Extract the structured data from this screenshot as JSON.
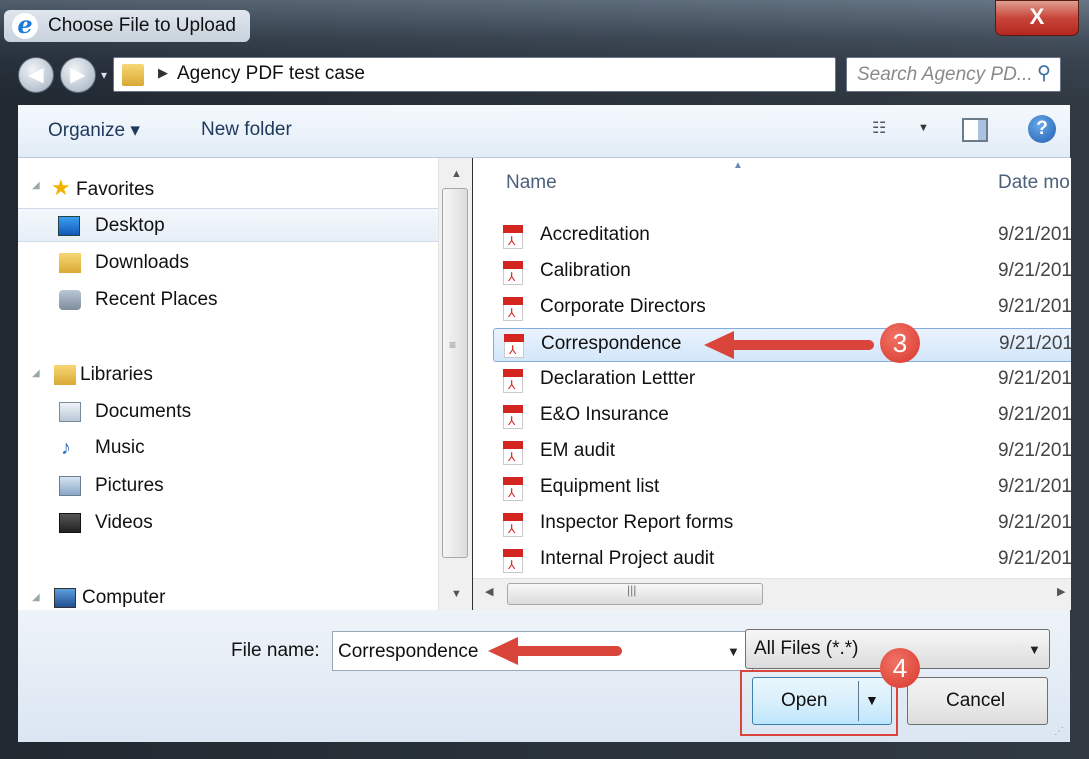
{
  "window": {
    "title": "Choose File to Upload",
    "close_glyph": "X"
  },
  "address": {
    "path": "Agency PDF test case",
    "search_placeholder": "Search Agency PD..."
  },
  "toolbar": {
    "organize": "Organize ▾",
    "new_folder": "New folder"
  },
  "nav": {
    "favorites": "Favorites",
    "desktop": "Desktop",
    "downloads": "Downloads",
    "recent": "Recent Places",
    "libraries": "Libraries",
    "documents": "Documents",
    "music": "Music",
    "pictures": "Pictures",
    "videos": "Videos",
    "computer": "Computer"
  },
  "columns": {
    "name": "Name",
    "date": "Date mo"
  },
  "files": [
    {
      "name": "Accreditation",
      "date": "9/21/201"
    },
    {
      "name": "Calibration",
      "date": "9/21/201"
    },
    {
      "name": "Corporate Directors",
      "date": "9/21/201"
    },
    {
      "name": "Correspondence",
      "date": "9/21/201"
    },
    {
      "name": "Declaration Lettter",
      "date": "9/21/201"
    },
    {
      "name": "E&O Insurance",
      "date": "9/21/201"
    },
    {
      "name": "EM audit",
      "date": "9/21/201"
    },
    {
      "name": "Equipment list",
      "date": "9/21/201"
    },
    {
      "name": "Inspector Report forms",
      "date": "9/21/201"
    },
    {
      "name": "Internal Project audit",
      "date": "9/21/201"
    }
  ],
  "selected_file_index": 3,
  "bottom": {
    "file_name_label": "File name:",
    "file_name_value": "Correspondence",
    "filter_value": "All Files (*.*)",
    "open_label": "Open",
    "cancel_label": "Cancel"
  },
  "annotations": {
    "step3": "3",
    "step4": "4"
  },
  "colors": {
    "accent": "#d9453b",
    "selection": "#d3e6fa",
    "link": "#1e395b"
  },
  "icons": [
    "ie-icon",
    "close-icon",
    "back-icon",
    "forward-icon",
    "folder-icon",
    "refresh-icon",
    "search-icon",
    "views-icon",
    "preview-pane-icon",
    "help-icon",
    "star-icon",
    "desktop-icon",
    "downloads-icon",
    "recent-places-icon",
    "libraries-icon",
    "documents-icon",
    "music-icon",
    "pictures-icon",
    "videos-icon",
    "computer-icon",
    "pdf-icon"
  ]
}
